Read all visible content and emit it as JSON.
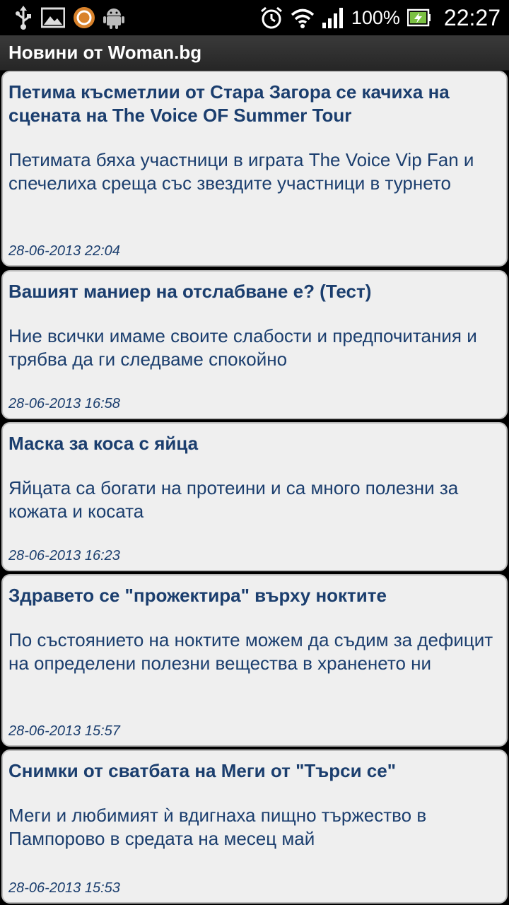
{
  "status_bar": {
    "icons_left": [
      "usb-icon",
      "gallery-icon",
      "app-circle-icon",
      "android-icon"
    ],
    "icons_right": [
      "alarm-icon",
      "wifi-icon",
      "signal-icon",
      "battery-icon"
    ],
    "battery_percent": "100%",
    "time": "22:27"
  },
  "app": {
    "title": "Новини от Woman.bg"
  },
  "colors": {
    "text": "#1b3e6e",
    "card_bg": "#efefef",
    "card_border": "#b9b9b9",
    "battery_fill": "#7bc043"
  },
  "articles": [
    {
      "title": "Петима късметлии от Стара Загора се качиха на сцената на The Voice OF Summer Tour",
      "summary": "Петимата бяха участници в играта The Voice Vip Fan и спечелиха среща със звездите участници в турнето",
      "date": "28-06-2013 22:04"
    },
    {
      "title": "Вашият маниер на отслабване е? (Тест)",
      "summary": "Ние всички имаме своите слабости и предпочитания и трябва да ги следваме спокойно",
      "date": "28-06-2013 16:58"
    },
    {
      "title": "Маска за коса с яйца",
      "summary": "Яйцата са богати на протеини и са много полезни за кожата и косата",
      "date": "28-06-2013 16:23"
    },
    {
      "title": "Здравето се \"прожектира\" върху ноктите",
      "summary": "По състоянието на ноктите можем да съдим за дефицит на определени полезни вещества в храненето ни",
      "date": "28-06-2013 15:57"
    },
    {
      "title": "Снимки от сватбата на Меги от \"Търси се\"",
      "summary": "Меги и любимият ѝ вдигнаха пищно тържество в Пампорово в средата на месец май",
      "date": "28-06-2013 15:53"
    }
  ]
}
